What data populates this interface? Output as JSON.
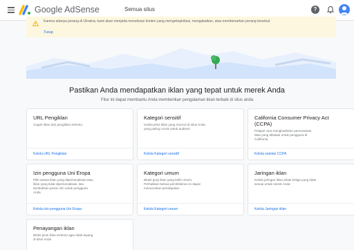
{
  "topbar": {
    "brand": "Google AdSense",
    "site_selector": "Semua situs"
  },
  "alert": {
    "text": "Karena adanya perang di Ukraina, kami akan menjeda monetisasi konten yang mengeksploitasi, mengabaikan, atau membenarkan perang tersebut",
    "link": "Tutup"
  },
  "main": {
    "heading": "Pastikan Anda mendapatkan iklan yang tepat untuk merek Anda",
    "subheading": "Fitur ini dapat membantu Anda memberikan pengalaman iklan terbaik di situs anda"
  },
  "cards": [
    {
      "title": "URL Pengiklan",
      "desc": "Cegah iklan dari pengiklan tertentu",
      "link": "Kelola URL Pengiklan"
    },
    {
      "title": "Kategori sensitif",
      "desc": "Kelola jenis iklan yang muncul di situs Anda yang paling cocok untuk audiens",
      "link": "Kelola Kategori sensitif"
    },
    {
      "title": "California Consumer Privacy Act (CCPA)",
      "desc": "Pelajari cara menghadirkan pemrosesan data yang dibatasi untuk pengguna di California",
      "link": "Kelola setelan CCPA"
    },
    {
      "title": "Izin pengguna Uni Eropa",
      "desc": "Pilih antara iklan yang dipersonalisasi atau iklan yang tidak dipersonalisasi, lalu tambahkan pesan izin untuk pengguna Anda",
      "link": "Kelola izin pengguna Uni Eropa"
    },
    {
      "title": "Kategori umum",
      "desc": "Blokir grup iklan yang lebih umum. Perhatikan bahwa pemblokiran ini dapat menurunkan pendapatan.",
      "link": "Kelola Kategori umum"
    },
    {
      "title": "Jaringan iklan",
      "desc": "Kelola jaringan iklan pihak ketiga yang tidak sesuai untuk merek Anda",
      "link": "Kelola Jaringan iklan"
    },
    {
      "title": "Penayangan iklan",
      "desc": "Blokir jenis iklan tertentu agar tidak tayang di situs Anda",
      "link": ""
    }
  ],
  "colors": {
    "link": "#1a73e8",
    "alert_bg": "#fef7e0",
    "alert_icon": "#f9ab00",
    "hero": "#e8f0fe"
  }
}
